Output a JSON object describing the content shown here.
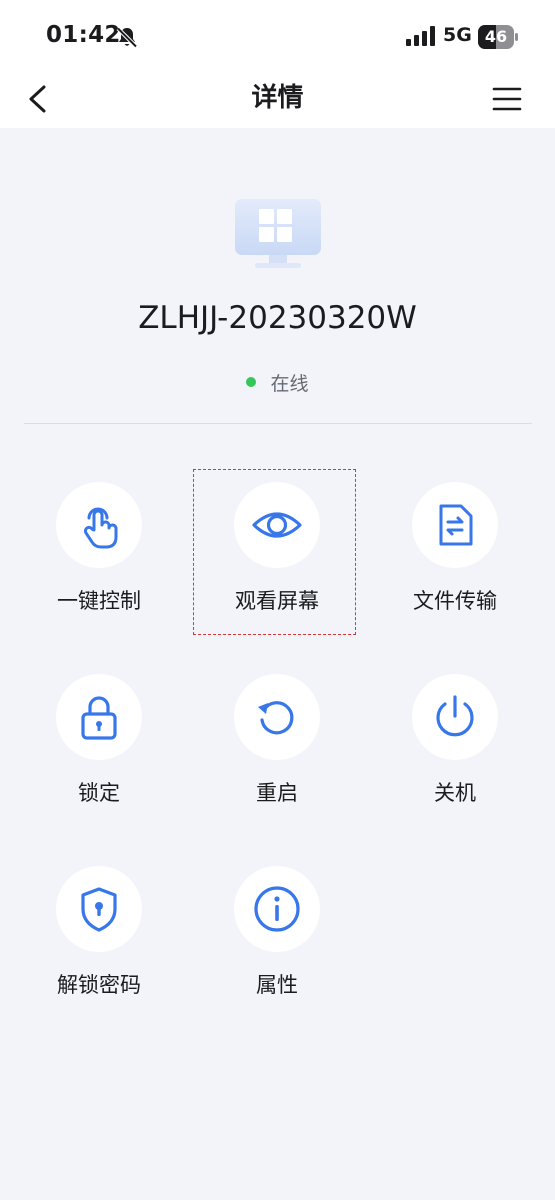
{
  "status_bar": {
    "time": "01:42",
    "network": "5G",
    "battery": "46"
  },
  "nav": {
    "title": "详情"
  },
  "device": {
    "name": "ZLHJJ-20230320W",
    "status": "在线"
  },
  "colors": {
    "accent": "#3777e9",
    "online": "#35c759",
    "highlight": "#d03a3a"
  },
  "actions": [
    {
      "label": "一键控制",
      "icon": "touch-hand-icon"
    },
    {
      "label": "观看屏幕",
      "icon": "eye-icon"
    },
    {
      "label": "文件传输",
      "icon": "file-transfer-icon"
    },
    {
      "label": "锁定",
      "icon": "lock-icon"
    },
    {
      "label": "重启",
      "icon": "restart-icon"
    },
    {
      "label": "关机",
      "icon": "power-icon"
    },
    {
      "label": "解锁密码",
      "icon": "shield-icon"
    },
    {
      "label": "属性",
      "icon": "info-icon"
    }
  ]
}
